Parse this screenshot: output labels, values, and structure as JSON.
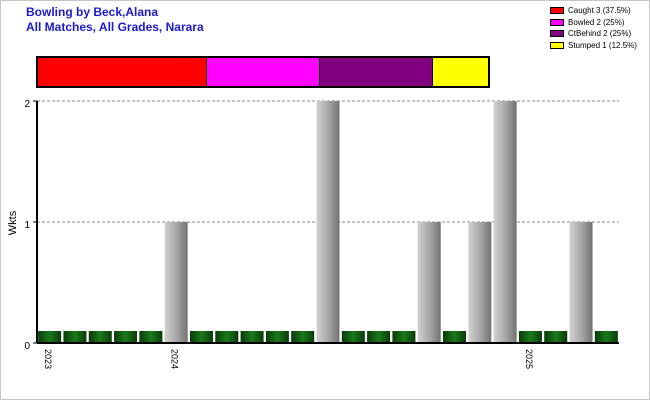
{
  "titles": {
    "line1": "Bowling by Beck,Alana",
    "line2": "All Matches, All Grades, Narara"
  },
  "legend": [
    {
      "label": "Caught 3 (37.5%)",
      "color": "#ff0000"
    },
    {
      "label": "Bowled 2 (25%)",
      "color": "#ff00ff"
    },
    {
      "label": "CtBehind 2 (25%)",
      "color": "#800080"
    },
    {
      "label": "Stumped 1 (12.5%)",
      "color": "#ffff00"
    }
  ],
  "chart_data": {
    "type": "bar",
    "ylabel": "Wkts",
    "ylim": [
      0,
      2
    ],
    "yticks": [
      "0",
      "1",
      "2"
    ],
    "grid": "horizontal dashed",
    "legend_position": "top-right",
    "values": [
      0,
      0,
      0,
      0,
      0,
      1,
      0,
      0,
      0,
      0,
      0,
      2,
      0,
      0,
      0,
      1,
      0,
      1,
      2,
      0,
      0,
      1,
      0
    ],
    "x_labels": [
      {
        "index": 0,
        "label": "2023"
      },
      {
        "index": 5,
        "label": "2024"
      },
      {
        "index": 19,
        "label": "2025"
      }
    ],
    "dismissal_breakdown": [
      {
        "name": "Caught",
        "count": 3,
        "color": "#ff0000"
      },
      {
        "name": "Bowled",
        "count": 2,
        "color": "#ff00ff"
      },
      {
        "name": "CtBehind",
        "count": 2,
        "color": "#800080"
      },
      {
        "name": "Stumped",
        "count": 1,
        "color": "#ffff00"
      }
    ]
  }
}
